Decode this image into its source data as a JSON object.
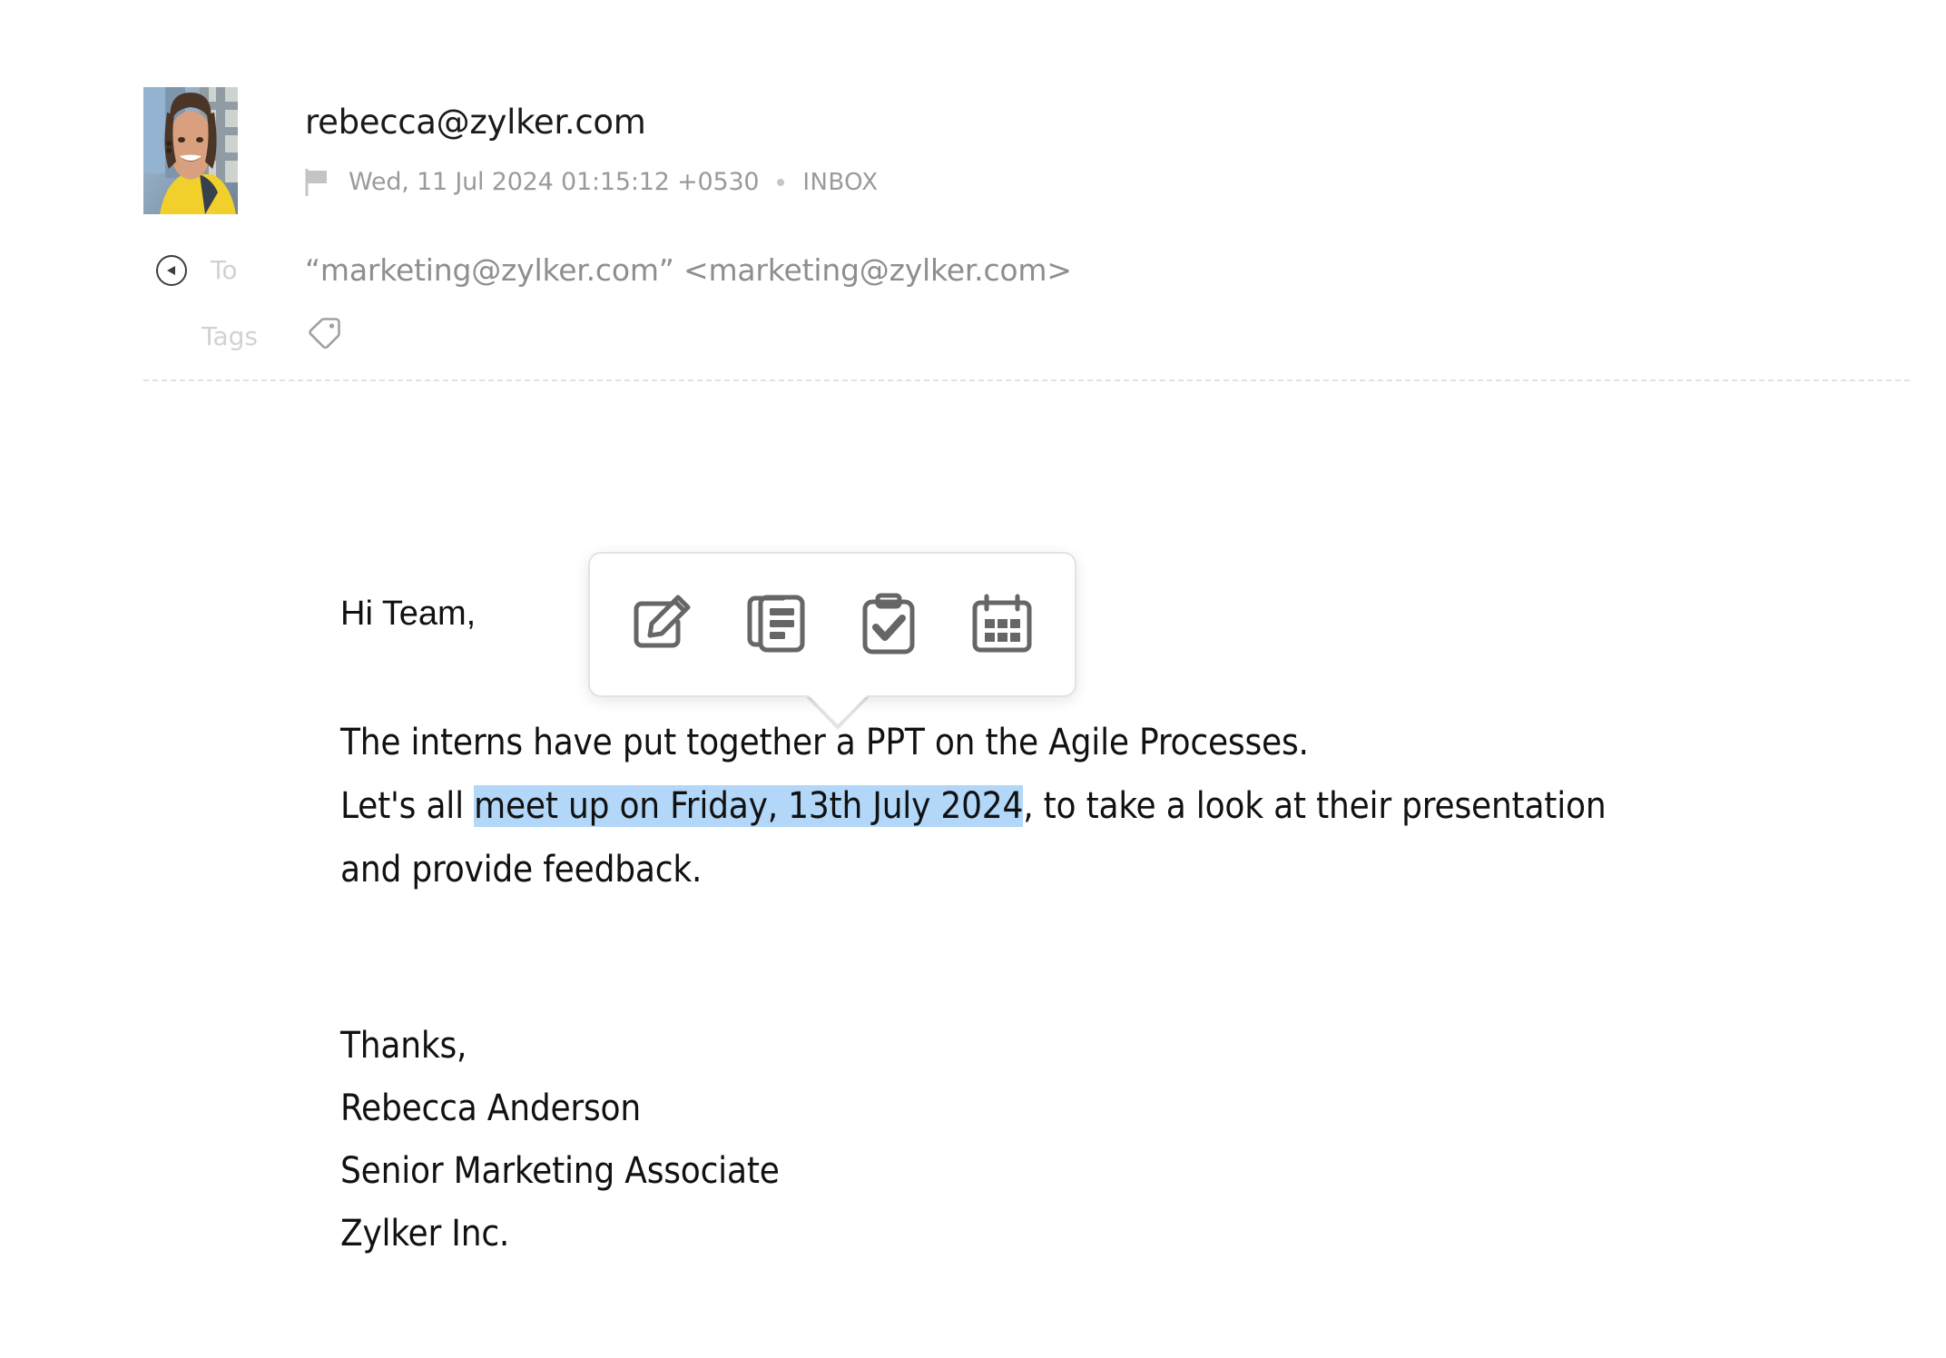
{
  "header": {
    "sender_email": "rebecca@zylker.com",
    "date": "Wed, 11 Jul 2024 01:15:12 +0530",
    "folder": "INBOX",
    "to_label": "To",
    "to_value": "“marketing@zylker.com” <marketing@zylker.com>",
    "tags_label": "Tags",
    "flag_icon": "flag-icon",
    "toggle_icon": "collapse-arrow-icon",
    "tag_icon": "tag-icon",
    "avatar_alt": "sender-avatar"
  },
  "body": {
    "greeting": "Hi Team,",
    "line_1": "The interns have put together a PPT on the Agile Processes.",
    "line_2_pre": "Let's all ",
    "line_2_selected": "meet up on Friday, 13th July 2024",
    "line_2_post": ", to take a look at their presentation",
    "line_3": "and provide feedback.",
    "signature": [
      "Thanks,",
      "Rebecca Anderson",
      "Senior Marketing Associate",
      "Zylker Inc."
    ]
  },
  "context_toolbar": {
    "actions": [
      {
        "name": "compose-icon",
        "label": "Compose"
      },
      {
        "name": "notes-icon",
        "label": "Notes"
      },
      {
        "name": "task-icon",
        "label": "Task"
      },
      {
        "name": "calendar-icon",
        "label": "Event"
      }
    ]
  },
  "colors": {
    "selection_highlight": "#b2d7f8",
    "muted_text": "#9a9a9a",
    "label_text": "#d2d2d2",
    "body_text": "#111111",
    "icon_stroke": "#666666",
    "divider": "#e2e2e2"
  }
}
